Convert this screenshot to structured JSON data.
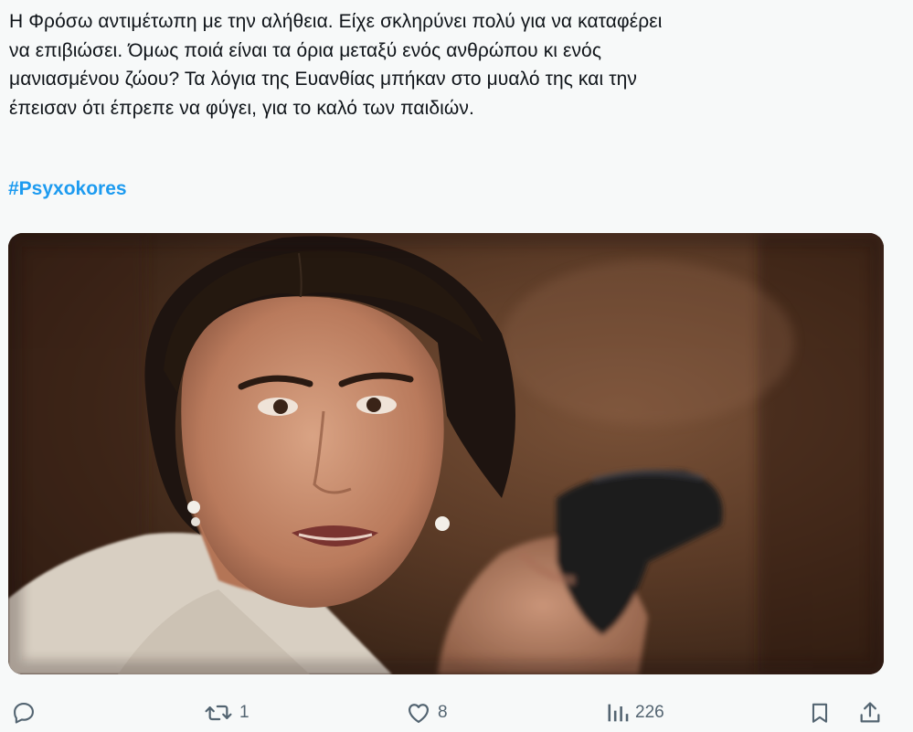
{
  "tweet": {
    "text": "Η Φρόσω αντιμέτωπη με την αλήθεια. Είχε σκληρύνει πολύ για να καταφέρει\nνα επιβιώσει. Όμως ποιά είναι τα όρια μεταξύ ενός ανθρώπου κι ενός\nμανιασμένου ζώου? Τα λόγια της Ευανθίας μπήκαν στο μυαλό της και την\nέπεισαν ότι έπρεπε να φύγει, για το καλό των παιδιών.",
    "hashtag": "#Psyxokores"
  },
  "media": {
    "description": "video-still-woman-holding-pistol"
  },
  "actions": {
    "reply": {
      "icon": "reply-icon",
      "count": ""
    },
    "retweet": {
      "icon": "retweet-icon",
      "count": "1"
    },
    "like": {
      "icon": "heart-icon",
      "count": "8"
    },
    "views": {
      "icon": "views-chart-icon",
      "count": "226"
    },
    "bookmark": {
      "icon": "bookmark-icon"
    },
    "share": {
      "icon": "share-icon"
    }
  },
  "colors": {
    "text": "#0f1419",
    "link": "#1d9bf0",
    "icon": "#536471",
    "background": "#f7f9f9"
  }
}
